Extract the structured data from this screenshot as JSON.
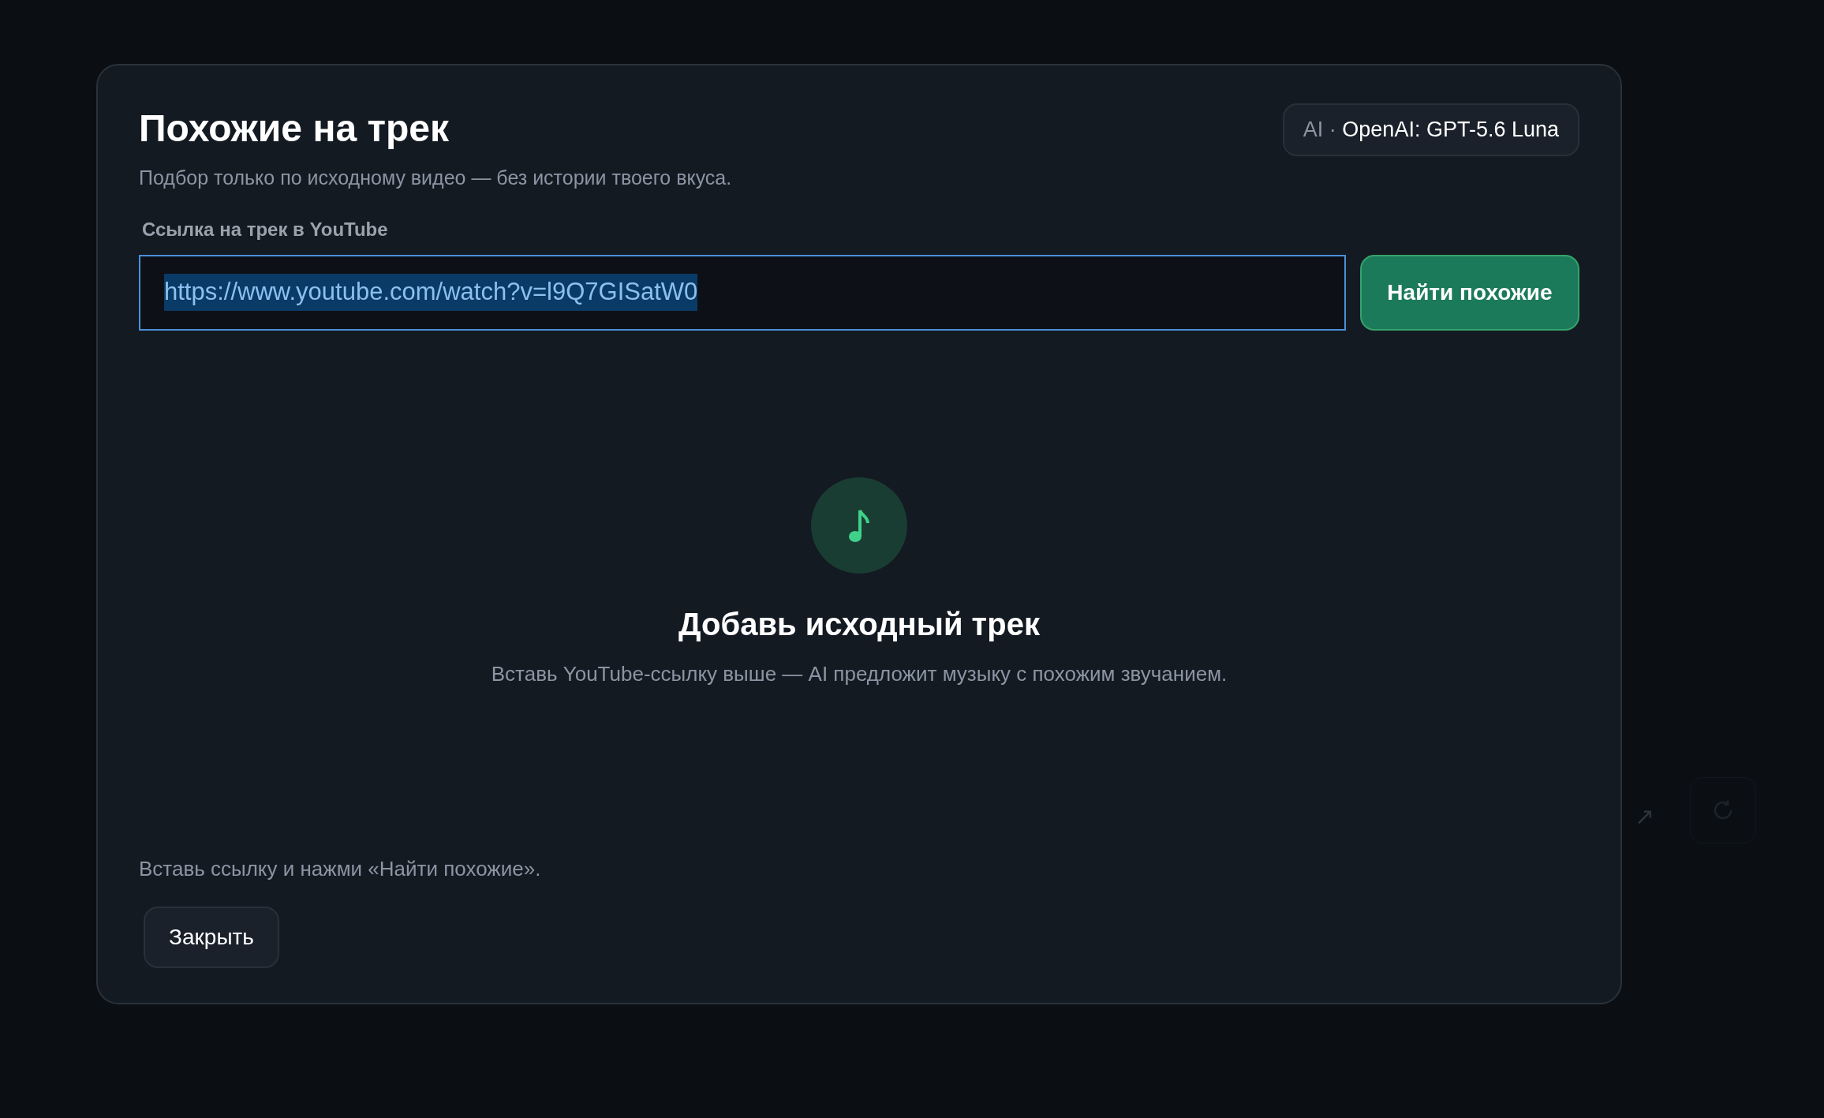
{
  "background": {
    "link_text": "↗"
  },
  "dialog": {
    "title": "Похожие на трек",
    "subtitle": "Подбор только по исходному видео — без истории твоего вкуса.",
    "model_badge": {
      "prefix": "AI ·",
      "model": "OpenAI: GPT-5.6 Luna"
    },
    "url_field": {
      "label": "Ссылка на трек в YouTube",
      "value": "https://www.youtube.com/watch?v=l9Q7GISatW0"
    },
    "search_button": "Найти похожие",
    "empty_state": {
      "title": "Добавь исходный трек",
      "text": "Вставь YouTube-ссылку выше — AI предложит музыку с похожим звучанием."
    },
    "hint": "Вставь ссылку и нажми «Найти похожие».",
    "close_button": "Закрыть"
  }
}
